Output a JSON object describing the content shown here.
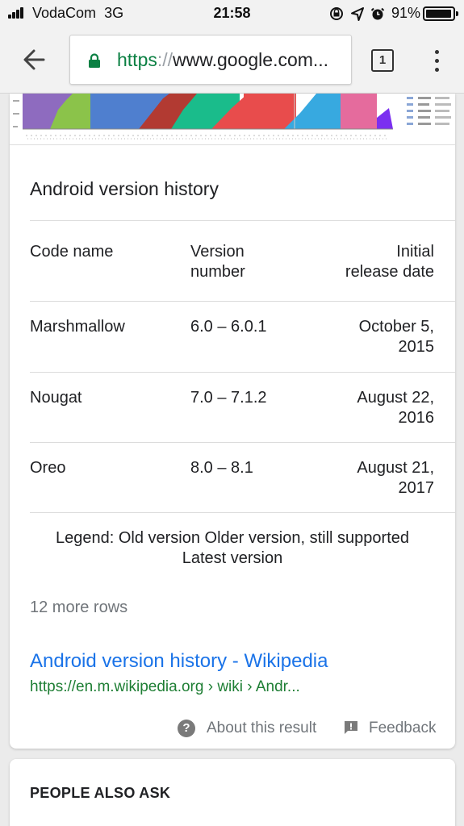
{
  "status_bar": {
    "carrier": "VodaCom",
    "network": "3G",
    "time": "21:58",
    "battery_percent": "91%",
    "icons": [
      "rotation-lock-icon",
      "location-icon",
      "alarm-icon"
    ]
  },
  "toolbar": {
    "url_scheme": "https",
    "url_separator": "://",
    "url_host": "www.google.com...",
    "tab_count": "1"
  },
  "card": {
    "section_title": "Android version history",
    "table": {
      "headers": {
        "code_name": "Code name",
        "version_line1": "Version",
        "version_line2": "number",
        "date_line1": "Initial",
        "date_line2": "release date"
      },
      "rows": [
        {
          "code_name": "Marshmallow",
          "version": "6.0 – 6.0.1",
          "date_line1": "October 5,",
          "date_line2": "2015"
        },
        {
          "code_name": "Nougat",
          "version": "7.0 – 7.1.2",
          "date_line1": "August 22,",
          "date_line2": "2016"
        },
        {
          "code_name": "Oreo",
          "version": "8.0 – 8.1",
          "date_line1": "August 21,",
          "date_line2": "2017"
        }
      ]
    },
    "legend_line1": "Legend: Old version Older version, still supported",
    "legend_line2": "Latest version",
    "more_rows": "12 more rows",
    "result_title": "Android version history - Wikipedia",
    "result_url": "https://en.m.wikipedia.org › wiki › Andr...",
    "about_label": "About this result",
    "feedback_label": "Feedback"
  },
  "people_also_ask": {
    "title": "PEOPLE ALSO ASK"
  },
  "colors": {
    "link": "#1a73e8",
    "url_green": "#1e7e34",
    "secure_green": "#0b8043"
  }
}
